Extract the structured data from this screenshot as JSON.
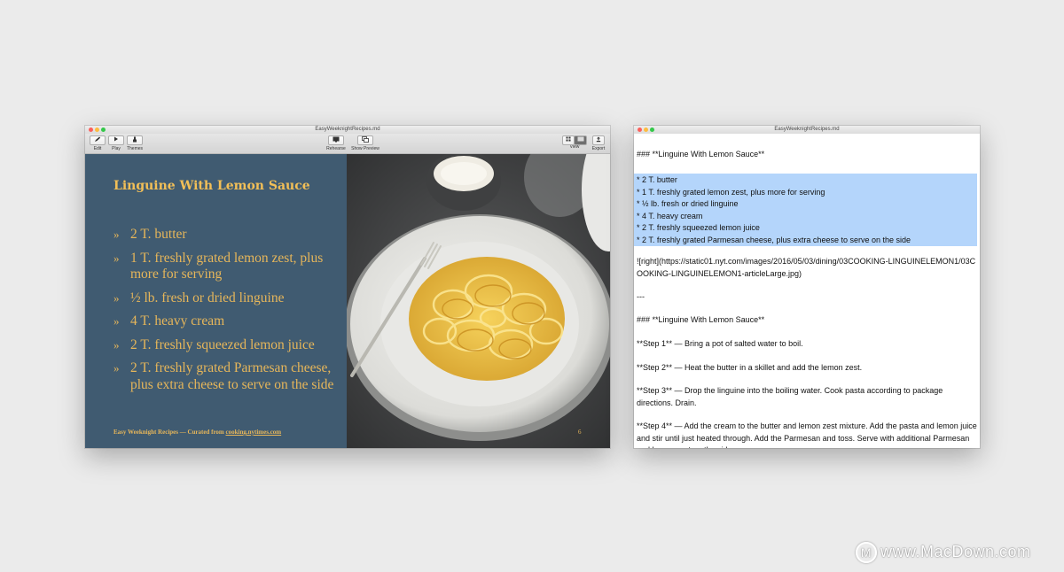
{
  "deck_window": {
    "title": "EasyWeeknightRecipes.md",
    "toolbar": {
      "edit": "Edit",
      "play": "Play",
      "themes": "Themes",
      "rehearse": "Rehearse",
      "show_preview": "Show Preview",
      "view": "View",
      "export": "Export"
    },
    "slide": {
      "title": "Linguine With Lemon Sauce",
      "bullet_marker": "»",
      "bullets": [
        "2 T. butter",
        "1 T. freshly grated lemon zest, plus more for serving",
        "½ lb. fresh or dried linguine",
        "4 T. heavy cream",
        "2 T. freshly squeezed lemon juice",
        "2 T. freshly grated Parmesan cheese, plus extra cheese to serve on the side"
      ],
      "footer_prefix": "Easy Weeknight Recipes — Curated from ",
      "footer_link": "cooking.nytimes.com",
      "page_number": "6"
    }
  },
  "editor_window": {
    "title": "EasyWeeknightRecipes.md",
    "heading_1": "### **Linguine With Lemon Sauce**",
    "selected_lines": [
      "* 2 T. butter",
      "* 1 T. freshly grated lemon zest, plus more for serving",
      "* ½ lb. fresh or dried linguine",
      "* 4 T. heavy cream",
      "* 2 T. freshly squeezed lemon juice",
      "* 2 T. freshly grated Parmesan cheese, plus extra cheese to serve on the side"
    ],
    "image_line": "![right](https://static01.nyt.com/images/2016/05/03/dining/03COOKING-LINGUINELEMON1/03COOKING-LINGUINELEMON1-articleLarge.jpg)",
    "separator": "---",
    "heading_2": "### **Linguine With Lemon Sauce**",
    "steps": [
      "**Step 1** — Bring a pot of salted water to boil.",
      "**Step 2** — Heat the butter in a skillet and add the lemon zest.",
      "**Step 3** — Drop the linguine into the boiling water. Cook pasta according to package directions. Drain.",
      "**Step 4** — Add the cream to the butter and lemon zest mixture. Add the pasta and lemon juice and stir until just heated through. Add the Parmesan and toss. Serve with additional Parmesan and lemon zest on the side."
    ]
  },
  "watermark": {
    "text": "www.MacDown.com",
    "logo_letter": "M"
  }
}
